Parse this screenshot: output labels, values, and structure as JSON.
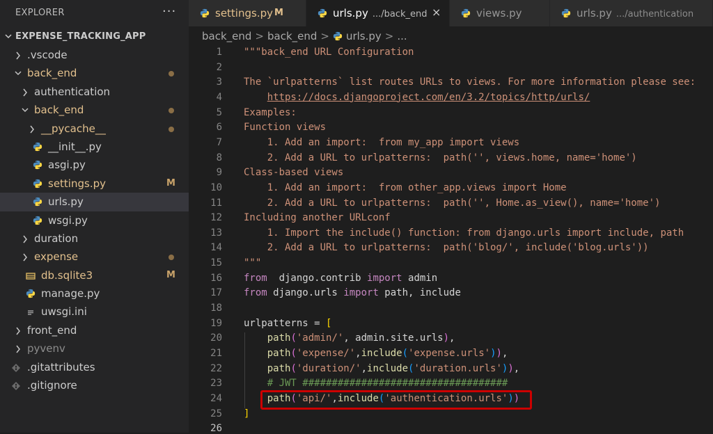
{
  "explorer": {
    "title": "EXPLORER",
    "more": "···",
    "root": "EXPENSE_TRACKING_APP",
    "items": [
      {
        "label": ".vscode",
        "kind": "folder",
        "depth": 0,
        "open": false,
        "status": ""
      },
      {
        "label": "back_end",
        "kind": "folder",
        "depth": 0,
        "open": true,
        "status": "dot"
      },
      {
        "label": "authentication",
        "kind": "folder",
        "depth": 1,
        "open": false,
        "status": ""
      },
      {
        "label": "back_end",
        "kind": "folder",
        "depth": 1,
        "open": true,
        "status": "dot"
      },
      {
        "label": "__pycache__",
        "kind": "folder",
        "depth": 2,
        "open": false,
        "status": "dot"
      },
      {
        "label": "__init__.py",
        "kind": "py",
        "depth": 2,
        "status": ""
      },
      {
        "label": "asgi.py",
        "kind": "py",
        "depth": 2,
        "status": ""
      },
      {
        "label": "settings.py",
        "kind": "py",
        "depth": 2,
        "status": "M"
      },
      {
        "label": "urls.py",
        "kind": "py",
        "depth": 2,
        "status": "",
        "selected": true
      },
      {
        "label": "wsgi.py",
        "kind": "py",
        "depth": 2,
        "status": ""
      },
      {
        "label": "duration",
        "kind": "folder",
        "depth": 1,
        "open": false,
        "status": ""
      },
      {
        "label": "expense",
        "kind": "folder",
        "depth": 1,
        "open": false,
        "status": "dot"
      },
      {
        "label": "db.sqlite3",
        "kind": "db",
        "depth": 1,
        "status": "M"
      },
      {
        "label": "manage.py",
        "kind": "py",
        "depth": 1,
        "status": ""
      },
      {
        "label": "uwsgi.ini",
        "kind": "ini",
        "depth": 1,
        "status": ""
      },
      {
        "label": "front_end",
        "kind": "folder",
        "depth": 0,
        "open": false,
        "status": ""
      },
      {
        "label": "pyvenv",
        "kind": "folder",
        "depth": 0,
        "open": false,
        "status": "",
        "dim": true
      },
      {
        "label": ".gitattributes",
        "kind": "git",
        "depth": 0,
        "status": ""
      },
      {
        "label": ".gitignore",
        "kind": "git",
        "depth": 0,
        "status": ""
      }
    ]
  },
  "tabs": [
    {
      "name": "settings.py",
      "desc": "",
      "mark": "M",
      "active": false
    },
    {
      "name": "urls.py",
      "desc": ".../back_end",
      "mark": "",
      "active": true,
      "close": "×"
    },
    {
      "name": "views.py",
      "desc": "",
      "mark": "",
      "active": false
    },
    {
      "name": "urls.py",
      "desc": ".../authentication",
      "mark": "",
      "active": false
    }
  ],
  "breadcrumbs": {
    "c1": "back_end",
    "c2": "back_end",
    "c3": "urls.py",
    "c4": "...",
    "sep": ">"
  },
  "editor": {
    "current_line": 26,
    "highlight_line": 24,
    "lines": [
      [
        [
          "c-str",
          "\"\"\"back_end URL Configuration"
        ]
      ],
      [],
      [
        [
          "c-str",
          "The `urlpatterns` list routes URLs to views. For more information please see:"
        ]
      ],
      [
        [
          "c-str",
          "    "
        ],
        [
          "c-link",
          "https://docs.djangoproject.com/en/3.2/topics/http/urls/"
        ]
      ],
      [
        [
          "c-str",
          "Examples:"
        ]
      ],
      [
        [
          "c-str",
          "Function views"
        ]
      ],
      [
        [
          "c-str",
          "    1. Add an import:  from my_app import views"
        ]
      ],
      [
        [
          "c-str",
          "    2. Add a URL to urlpatterns:  path('', views.home, name='home')"
        ]
      ],
      [
        [
          "c-str",
          "Class-based views"
        ]
      ],
      [
        [
          "c-str",
          "    1. Add an import:  from other_app.views import Home"
        ]
      ],
      [
        [
          "c-str",
          "    2. Add a URL to urlpatterns:  path('', Home.as_view(), name='home')"
        ]
      ],
      [
        [
          "c-str",
          "Including another URLconf"
        ]
      ],
      [
        [
          "c-str",
          "    1. Import the include() function: from django.urls import include, path"
        ]
      ],
      [
        [
          "c-str",
          "    2. Add a URL to urlpatterns:  path('blog/', include('blog.urls'))"
        ]
      ],
      [
        [
          "c-str",
          "\"\"\""
        ]
      ],
      [
        [
          "c-kw",
          "from"
        ],
        [
          "",
          "  django.contrib "
        ],
        [
          "c-kw",
          "import"
        ],
        [
          "",
          " admin"
        ]
      ],
      [
        [
          "c-kw",
          "from"
        ],
        [
          "",
          " django.urls "
        ],
        [
          "c-kw",
          "import"
        ],
        [
          "",
          " path, include"
        ]
      ],
      [],
      [
        [
          "",
          "urlpatterns = "
        ],
        [
          "c-yb",
          "["
        ]
      ],
      [
        [
          "",
          "    "
        ],
        [
          "c-fn",
          "path"
        ],
        [
          "c-pb",
          "("
        ],
        [
          "c-str",
          "'admin/'"
        ],
        [
          "",
          ", admin.site.urls"
        ],
        [
          "c-pb",
          ")"
        ],
        [
          "",
          ","
        ]
      ],
      [
        [
          "",
          "    "
        ],
        [
          "c-fn",
          "path"
        ],
        [
          "c-pb",
          "("
        ],
        [
          "c-str",
          "'expense/'"
        ],
        [
          "",
          ","
        ],
        [
          "c-fn",
          "include"
        ],
        [
          "c-bb",
          "("
        ],
        [
          "c-str",
          "'expense.urls'"
        ],
        [
          "c-bb",
          ")"
        ],
        [
          "c-pb",
          ")"
        ],
        [
          "",
          ","
        ]
      ],
      [
        [
          "",
          "    "
        ],
        [
          "c-fn",
          "path"
        ],
        [
          "c-pb",
          "("
        ],
        [
          "c-str",
          "'duration/'"
        ],
        [
          "",
          ","
        ],
        [
          "c-fn",
          "include"
        ],
        [
          "c-bb",
          "("
        ],
        [
          "c-str",
          "'duration.urls'"
        ],
        [
          "c-bb",
          ")"
        ],
        [
          "c-pb",
          ")"
        ],
        [
          "",
          ","
        ]
      ],
      [
        [
          "",
          "    "
        ],
        [
          "c-com",
          "# JWT ###################################"
        ]
      ],
      [
        [
          "",
          "    "
        ],
        [
          "c-fn",
          "path"
        ],
        [
          "c-pb",
          "("
        ],
        [
          "c-str",
          "'api/'"
        ],
        [
          "",
          ","
        ],
        [
          "c-fn",
          "include"
        ],
        [
          "c-bb",
          "("
        ],
        [
          "c-str",
          "'authentication.urls'"
        ],
        [
          "c-bb",
          ")"
        ],
        [
          "c-pb",
          ")"
        ]
      ],
      [
        [
          "c-yb",
          "]"
        ]
      ],
      []
    ]
  }
}
